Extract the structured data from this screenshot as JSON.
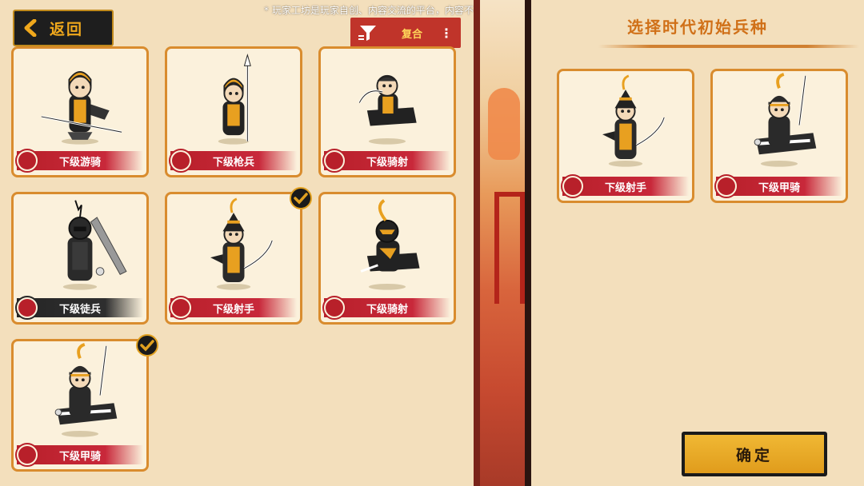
{
  "header": {
    "back_label": "返回",
    "notice": "* 玩家工坊是玩家自创、内容交流的平台，内容不代表制作组立场"
  },
  "filter": {
    "label": "复合",
    "more": "⋮"
  },
  "units": [
    {
      "name": "下级游骑",
      "tag_color": "#b8202a",
      "checked": false
    },
    {
      "name": "下级枪兵",
      "tag_color": "#b8202a",
      "checked": false
    },
    {
      "name": "下级骑射",
      "tag_color": "#b8202a",
      "checked": false
    },
    {
      "name": "下级徒兵",
      "tag_color": "#262626",
      "checked": false
    },
    {
      "name": "下级射手",
      "tag_color": "#b8202a",
      "checked": true
    },
    {
      "name": "下级骑射",
      "tag_color": "#b8202a",
      "checked": false
    },
    {
      "name": "下级甲骑",
      "tag_color": "#b8202a",
      "checked": true
    }
  ],
  "selection_panel": {
    "title": "选择时代初始兵种",
    "selected": [
      {
        "name": "下级射手"
      },
      {
        "name": "下级甲骑"
      }
    ],
    "confirm_label": "确定"
  },
  "colors": {
    "background": "#f3dfbc",
    "card_border": "#d98c2e",
    "tag_red": "#b8202a",
    "tag_dark": "#262626",
    "title": "#d07018",
    "accent_gold": "#e0a020"
  }
}
